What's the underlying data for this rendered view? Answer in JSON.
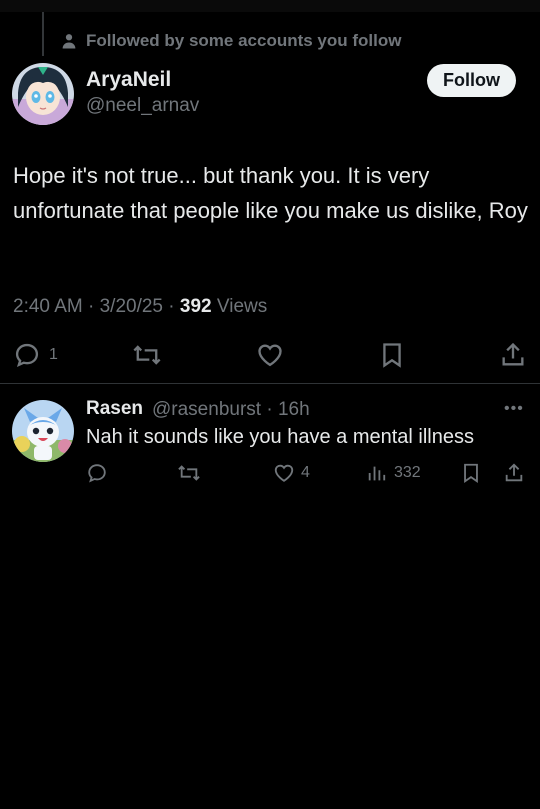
{
  "social_context": {
    "text": "Followed by some accounts you follow",
    "icon": "person-icon"
  },
  "post": {
    "author_name": "AryaNeil",
    "author_handle": "@neel_arnav",
    "follow_label": "Follow",
    "text": "Hope it's not true... but thank you. It is very unfortunate that people like you make us dislike, Roy",
    "time": "2:40 AM",
    "date": "3/20/25",
    "views": "392",
    "views_label": "Views",
    "actions": {
      "reply_count": "1",
      "repost_count": "",
      "like_count": ""
    }
  },
  "reply": {
    "author_name": "Rasen",
    "author_handle": "@rasenburst",
    "time": "16h",
    "text": "Nah it sounds like you have a mental illness",
    "actions": {
      "reply_count": "",
      "repost_count": "",
      "like_count": "4",
      "views_count": "332"
    }
  },
  "colors": {
    "background": "#000000",
    "primary_text": "#e7e9ea",
    "secondary_text": "#71767b",
    "divider": "#2f3336",
    "follow_button_bg": "#eff3f4"
  }
}
